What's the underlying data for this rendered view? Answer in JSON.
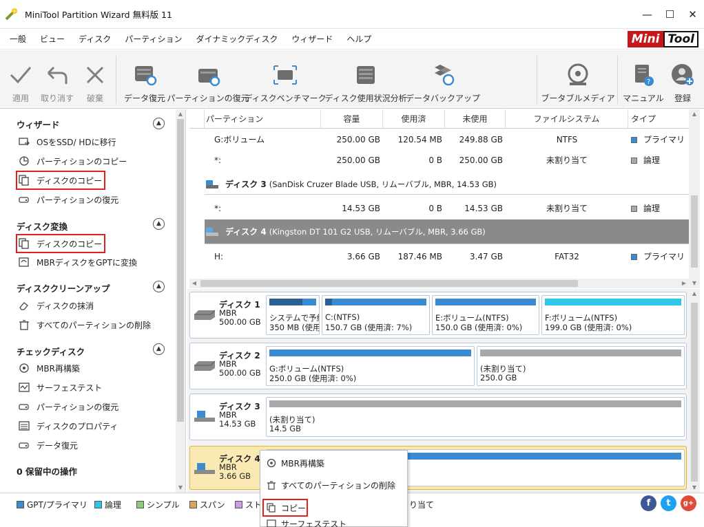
{
  "window": {
    "title": "MiniTool Partition Wizard 無料版 11",
    "controls": [
      "—",
      "☐",
      "✕"
    ]
  },
  "menu": [
    "一般",
    "ビュー",
    "ディスク",
    "パーティション",
    "ダイナミックディスク",
    "ウィザード",
    "ヘルプ"
  ],
  "logo": {
    "part1": "Mini",
    "part2": "Tool"
  },
  "toolbar": {
    "apply": "適用",
    "undo": "取り消す",
    "discard": "破棄",
    "data_recovery": "データ復元",
    "partition_recovery": "パーティションの復元",
    "disk_benchmark": "ディスクベンチマーク",
    "space_analyzer": "ディスク使用状況分析",
    "data_backup": "データバックアップ",
    "bootable_media": "ブータブルメディア",
    "manual": "マニュアル",
    "register": "登録"
  },
  "sidebar": {
    "sections": [
      {
        "title": "ウィザード",
        "items": [
          "OSをSSD/ HDに移行",
          "パーティションのコピー",
          "ディスクのコピー",
          "パーティションの復元"
        ]
      },
      {
        "title": "ディスク変換",
        "items": [
          "ディスクのコピー",
          "MBRディスクをGPTに変換"
        ]
      },
      {
        "title": "ディスククリーンアップ",
        "items": [
          "ディスクの抹消",
          "すべてのパーティションの削除"
        ]
      },
      {
        "title": "チェックディスク",
        "items": [
          "MBR再構築",
          "サーフェステスト",
          "パーティションの復元",
          "ディスクのプロパティ",
          "データ復元"
        ]
      }
    ],
    "pending": "0 保留中の操作"
  },
  "table": {
    "headers": [
      "パーティション",
      "容量",
      "使用済",
      "未使用",
      "ファイルシステム",
      "タイプ"
    ],
    "rows": [
      {
        "partition": "G:ボリューム",
        "capacity": "250.00 GB",
        "used": "120.54 MB",
        "unused": "249.88 GB",
        "fs": "NTFS",
        "type": "プライマリ"
      },
      {
        "partition": "*:",
        "capacity": "250.00 GB",
        "used": "0 B",
        "unused": "250.00 GB",
        "fs": "未割り当て",
        "type": "論理"
      }
    ],
    "disk3": {
      "name": "ディスク 3",
      "desc": "(SanDisk Cruzer Blade USB, リムーバブル, MBR, 14.53 GB)"
    },
    "disk3_rows": [
      {
        "partition": "*:",
        "capacity": "14.53 GB",
        "used": "0 B",
        "unused": "14.53 GB",
        "fs": "未割り当て",
        "type": "論理"
      }
    ],
    "disk4": {
      "name": "ディスク 4",
      "desc": "(Kingston DT 101 G2 USB, リムーバブル, MBR, 3.66 GB)"
    },
    "disk4_rows": [
      {
        "partition": "H:",
        "capacity": "3.66 GB",
        "used": "187.46 MB",
        "unused": "3.47 GB",
        "fs": "FAT32",
        "type": "プライマリ"
      }
    ]
  },
  "diskmap": [
    {
      "name": "ディスク 1",
      "type": "MBR",
      "size": "500.00 GB",
      "partitions": [
        {
          "l1": "システムで予約",
          "l2": "350 MB (使用",
          "used_fraction": 0.7
        },
        {
          "l1": "C:(NTFS)",
          "l2": "150.7 GB (使用済: 7%)",
          "used_fraction": 0.07
        },
        {
          "l1": "E:ボリューム(NTFS)",
          "l2": "150.0 GB (使用済: 0%)",
          "used_fraction": 0.0
        },
        {
          "l1": "F:ボリューム(NTFS)",
          "l2": "199.0 GB (使用済: 0%)",
          "used_fraction": 0.0
        }
      ]
    },
    {
      "name": "ディスク 2",
      "type": "MBR",
      "size": "500.00 GB",
      "partitions": [
        {
          "l1": "G:ボリューム(NTFS)",
          "l2": "250.0 GB (使用済: 0%)",
          "used_fraction": 0.0
        },
        {
          "l1": "(未割り当て)",
          "l2": "250.0 GB",
          "used_fraction": 0.0
        }
      ]
    },
    {
      "name": "ディスク 3",
      "type": "MBR",
      "size": "14.53 GB",
      "partitions": [
        {
          "l1": "(未割り当て)",
          "l2": "14.5 GB",
          "used_fraction": 0.0
        }
      ]
    },
    {
      "name": "ディスク 4",
      "type": "MBR",
      "size": "3.66 GB",
      "partitions": [
        {
          "l1": "",
          "l2": "",
          "used_fraction": 0.05
        }
      ]
    }
  ],
  "legend": [
    {
      "label": "GPT/プライマリ",
      "color": "#3a8bd1"
    },
    {
      "label": "論理",
      "color": "#2fc6e8"
    },
    {
      "label": "シンプル",
      "color": "#8dc87c"
    },
    {
      "label": "スパン",
      "color": "#d9a45c"
    },
    {
      "label": "スト",
      "color": "#c89ee0"
    },
    {
      "label": "り当て",
      "color": ""
    }
  ],
  "context_menu": [
    "MBR再構築",
    "すべてのパーティションの削除",
    "コピー",
    "サーフェステスト"
  ],
  "colors": {
    "primary": "#3a8bd1",
    "logical": "#2fc6e8",
    "unallocated": "#a8a8a8",
    "highlight": "#e02020",
    "selected_disk": "#fbe9b4",
    "logo_red": "#c8161d"
  },
  "social": [
    "f",
    "t",
    "g+"
  ]
}
